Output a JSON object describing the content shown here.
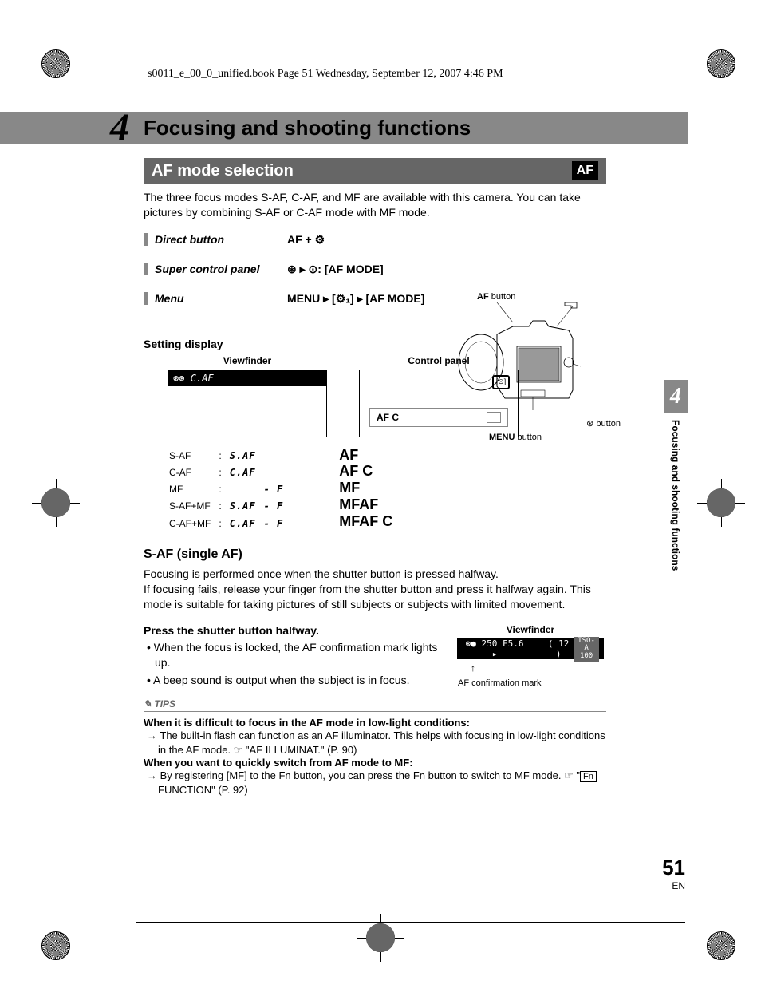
{
  "header_text": "s0011_e_00_0_unified.book  Page 51  Wednesday, September 12, 2007  4:46 PM",
  "chapter": {
    "number": "4",
    "title": "Focusing and shooting functions"
  },
  "subheader": {
    "title": "AF mode selection",
    "badge": "AF"
  },
  "intro": "The three focus modes S-AF, C-AF, and MF are available with this camera. You can take pictures by combining S-AF or C-AF mode with MF mode.",
  "access": {
    "direct": {
      "label": "Direct button",
      "value": "AF + ⚙"
    },
    "scp": {
      "label": "Super control panel",
      "value": "⊛ ▸ ⊙: [AF MODE]"
    },
    "menu": {
      "label": "Menu",
      "value": "MENU ▸ [⚙₁] ▸ [AF MODE]"
    }
  },
  "camera_labels": {
    "af": "AF",
    "af_button_suffix": " button",
    "ok": "⊛",
    "ok_button_suffix": " button",
    "menu": "MENU",
    "menu_button_suffix": " button"
  },
  "setting_heading": "Setting display",
  "displays": {
    "viewfinder": "Viewfinder",
    "control": "Control panel",
    "vf_content": "⊛⊛ C.AF",
    "cp_text": "AF C"
  },
  "mode_rows": [
    {
      "name": "S-AF",
      "seg1": "S.AF",
      "seg2": ""
    },
    {
      "name": "C-AF",
      "seg1": "C.AF",
      "seg2": ""
    },
    {
      "name": "MF",
      "seg1": "",
      "seg2": "- F"
    },
    {
      "name": "S-AF+MF",
      "seg1": "S.AF",
      "seg2": "- F"
    },
    {
      "name": "C-AF+MF",
      "seg1": "C.AF",
      "seg2": "- F"
    }
  ],
  "mode_panel": [
    "AF",
    "AF C",
    "MF",
    "MFAF",
    "MFAF C"
  ],
  "saf": {
    "heading": "S-AF (single AF)",
    "body": "Focusing is performed once when the shutter button is pressed halfway.\nIf focusing fails, release your finger from the shutter button and press it halfway again. This mode is suitable for taking pictures of still subjects or subjects with limited movement.",
    "step": "Press the shutter button halfway.",
    "bullet1": "When the focus is locked, the AF confirmation mark lights up.",
    "bullet2": "A beep sound is output when the subject is in focus."
  },
  "vf2": {
    "label": "Viewfinder",
    "content": "⊛● 250  F5.6 ▸",
    "frames": "( 12 )",
    "isoa": "ISO-A",
    "iso": "100",
    "caption": "AF confirmation mark"
  },
  "tips": {
    "header": "✎ TIPS",
    "h1": "When it is difficult to focus in the AF mode in low-light conditions:",
    "b1_pre": "→ The built-in flash can function as an AF illuminator. This helps with focusing in low-light conditions in the AF mode. ☞ \"AF ILLUMINAT.\" (P. 90)",
    "h2": "When you want to quickly switch from AF mode to MF:",
    "b2": "→ By registering [MF] to the Fn button, you can press the Fn button to switch to MF mode. ☞ \"",
    "b2_fn": "Fn",
    "b2_suffix": " FUNCTION\" (P. 92)"
  },
  "side": {
    "num": "4",
    "text": "Focusing and shooting functions"
  },
  "page": {
    "num": "51",
    "lang": "EN"
  }
}
